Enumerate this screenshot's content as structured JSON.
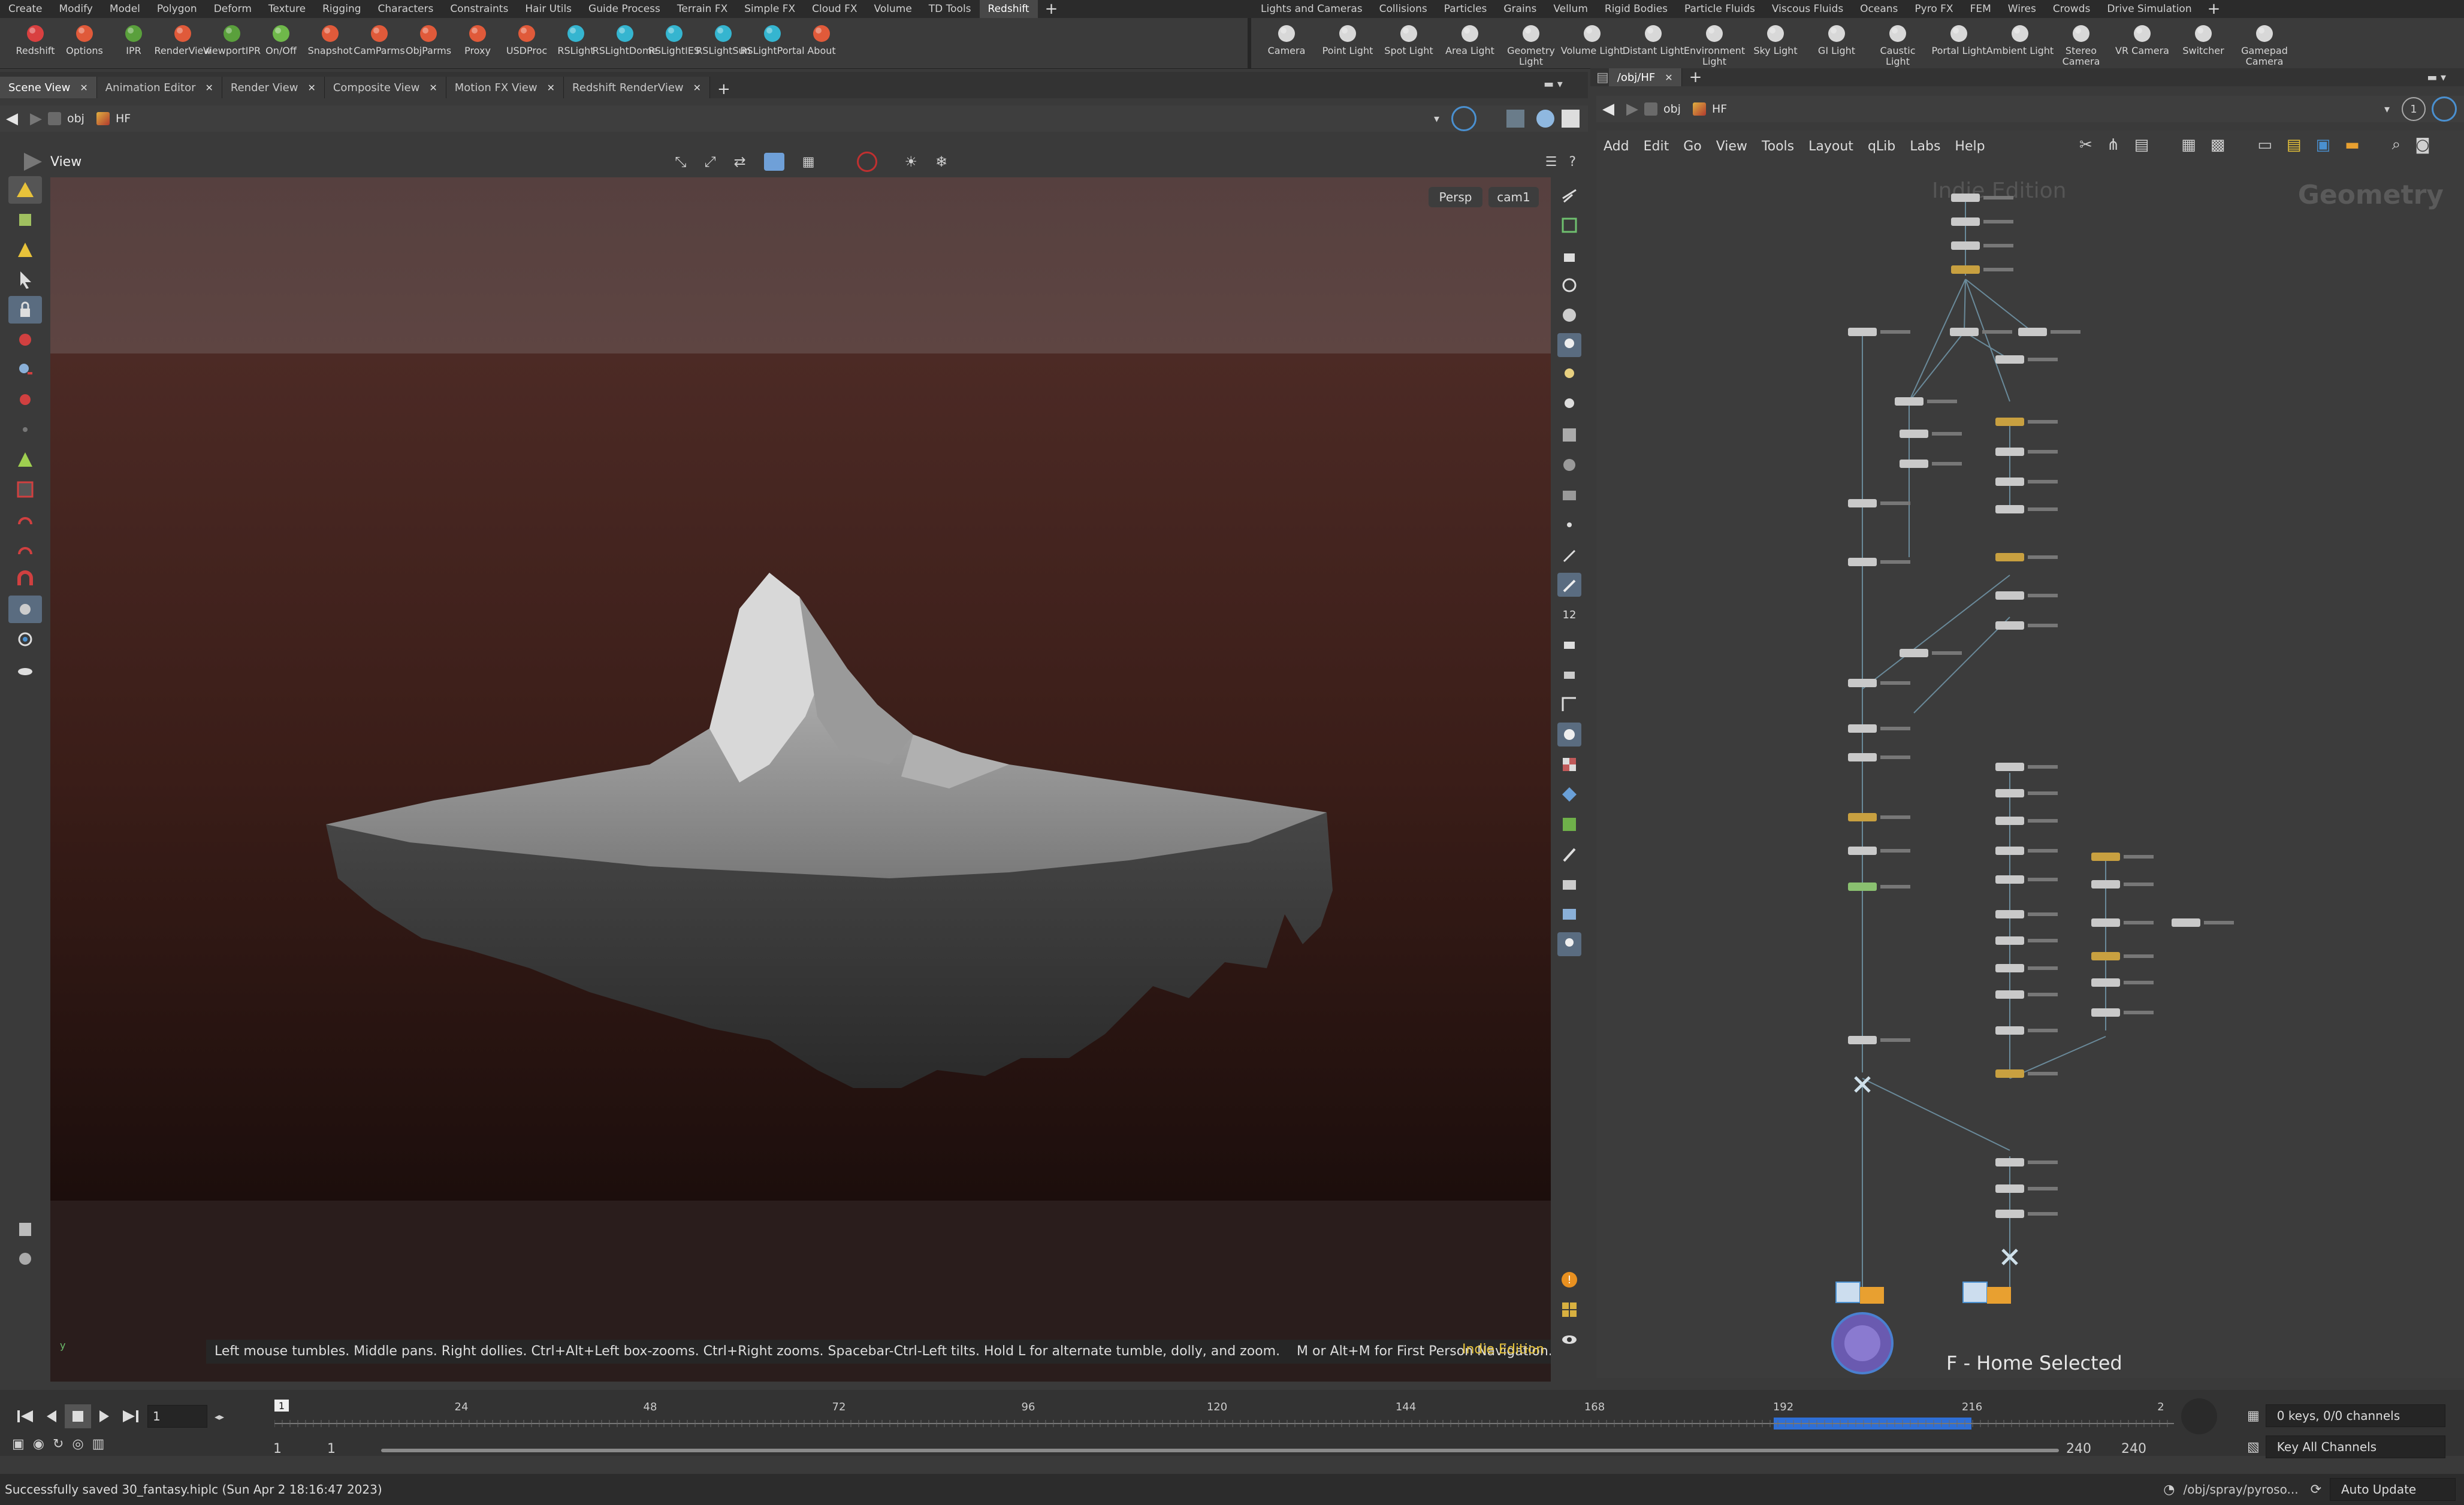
{
  "menubar": {
    "left": [
      "Create",
      "Modify",
      "Model",
      "Polygon",
      "Deform",
      "Texture",
      "Rigging",
      "Characters",
      "Constraints",
      "Hair Utils",
      "Guide Process",
      "Terrain FX",
      "Simple FX",
      "Cloud FX",
      "Volume",
      "TD Tools",
      "Redshift"
    ],
    "left_active": "Redshift",
    "right": [
      "Lights and Cameras",
      "Collisions",
      "Particles",
      "Grains",
      "Vellum",
      "Rigid Bodies",
      "Particle Fluids",
      "Viscous Fluids",
      "Oceans",
      "Pyro FX",
      "FEM",
      "Wires",
      "Crowds",
      "Drive Simulation"
    ],
    "right_active": "Lights and Cameras",
    "add_symbol": "+"
  },
  "shelf_left": [
    {
      "label": "Redshift",
      "icon": "redshift-icon",
      "color": "#d94040"
    },
    {
      "label": "Options",
      "icon": "options-icon",
      "color": "#e05a3a"
    },
    {
      "label": "IPR",
      "icon": "ipr-icon",
      "color": "#5aa03c"
    },
    {
      "label": "RenderView",
      "icon": "renderview-icon",
      "color": "#e05a3a"
    },
    {
      "label": "ViewportIPR",
      "icon": "viewport-ipr-icon",
      "color": "#5aa03c"
    },
    {
      "label": "On/Off",
      "icon": "onoff-icon",
      "color": "#6fb84a"
    },
    {
      "label": "Snapshot",
      "icon": "snapshot-icon",
      "color": "#e05a3a"
    },
    {
      "label": "CamParms",
      "icon": "camparms-icon",
      "color": "#e05a3a"
    },
    {
      "label": "ObjParms",
      "icon": "objparms-icon",
      "color": "#e05a3a"
    },
    {
      "label": "Proxy",
      "icon": "proxy-icon",
      "color": "#e05a3a"
    },
    {
      "label": "USDProc",
      "icon": "usdproc-icon",
      "color": "#e05a3a"
    },
    {
      "label": "RSLight",
      "icon": "rslight-icon",
      "color": "#35b5d0"
    },
    {
      "label": "RSLightDome",
      "icon": "rslight-dome-icon",
      "color": "#35b5d0"
    },
    {
      "label": "RSLightIES",
      "icon": "rslight-ies-icon",
      "color": "#35b5d0"
    },
    {
      "label": "RSLightSun",
      "icon": "rslight-sun-icon",
      "color": "#35b5d0"
    },
    {
      "label": "RSLightPortal",
      "icon": "rslight-portal-icon",
      "color": "#35b5d0"
    },
    {
      "label": "About",
      "icon": "about-icon",
      "color": "#e05a3a"
    }
  ],
  "shelf_right": [
    {
      "label": "Camera",
      "icon": "camera-icon"
    },
    {
      "label": "Point Light",
      "icon": "point-light-icon"
    },
    {
      "label": "Spot Light",
      "icon": "spot-light-icon"
    },
    {
      "label": "Area Light",
      "icon": "area-light-icon"
    },
    {
      "label": "Geometry\nLight",
      "icon": "geometry-light-icon"
    },
    {
      "label": "Volume Light",
      "icon": "volume-light-icon"
    },
    {
      "label": "Distant Light",
      "icon": "distant-light-icon"
    },
    {
      "label": "Environment\nLight",
      "icon": "environment-light-icon"
    },
    {
      "label": "Sky Light",
      "icon": "sky-light-icon"
    },
    {
      "label": "GI Light",
      "icon": "gi-light-icon"
    },
    {
      "label": "Caustic\nLight",
      "icon": "caustic-light-icon"
    },
    {
      "label": "Portal Light",
      "icon": "portal-light-icon"
    },
    {
      "label": "Ambient Light",
      "icon": "ambient-light-icon"
    },
    {
      "label": "Stereo\nCamera",
      "icon": "stereo-camera-icon"
    },
    {
      "label": "VR Camera",
      "icon": "vr-camera-icon"
    },
    {
      "label": "Switcher",
      "icon": "switcher-icon"
    },
    {
      "label": "Gamepad\nCamera",
      "icon": "gamepad-camera-icon"
    }
  ],
  "pane_tabs": [
    "Scene View",
    "Animation Editor",
    "Render View",
    "Composite View",
    "Motion FX View",
    "Redshift RenderView"
  ],
  "pane_tabs_active": "Scene View",
  "net_tab": "/obj/HF",
  "path_left": {
    "obj": "obj",
    "node": "HF"
  },
  "path_right": {
    "obj": "obj",
    "node": "HF"
  },
  "viewport": {
    "title": "View",
    "persp": "Persp",
    "camera": "cam1",
    "hint": "Left mouse tumbles. Middle pans. Right dollies. Ctrl+Alt+Left box-zooms. Ctrl+Right zooms. Spacebar-Ctrl-Left tilts. Hold L for alternate tumble, dolly, and zoom.    M or Alt+M for First Person Navigation.",
    "edition": "Indie Edition"
  },
  "network": {
    "menu": [
      "Add",
      "Edit",
      "Go",
      "View",
      "Tools",
      "Layout",
      "qLib",
      "Labs",
      "Help"
    ],
    "watermark_edition": "Indie Edition",
    "context": "Geometry",
    "home_hint": "F - Home Selected",
    "page_number": "1"
  },
  "timeline": {
    "ticks": [
      "24",
      "48",
      "72",
      "96",
      "120",
      "144",
      "168",
      "192",
      "216",
      "2"
    ],
    "frame_marker": "1",
    "current_frame": "1",
    "range_start": "1",
    "range_start2": "1",
    "range_end": "240",
    "range_end2": "240",
    "keys_info": "0 keys, 0/0 channels",
    "key_all": "Key All Channels"
  },
  "status": {
    "message": "Successfully saved 30_fantasy.hiplc (Sun Apr  2 18:16:47 2023)",
    "path": "/obj/spray/pyroso...",
    "update_mode": "Auto Update"
  },
  "colors": {
    "accent": "#2f6fd6",
    "menu_bg": "#2b2b2b",
    "edition": "#e8c43a"
  }
}
